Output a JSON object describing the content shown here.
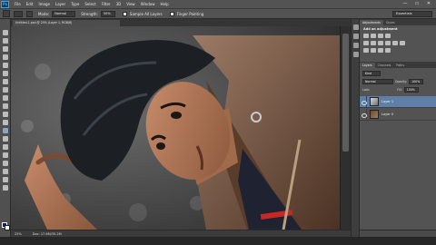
{
  "app": {
    "logo": "Ps"
  },
  "menu": [
    "File",
    "Edit",
    "Image",
    "Layer",
    "Type",
    "Select",
    "Filter",
    "3D",
    "View",
    "Window",
    "Help"
  ],
  "window_controls": [
    "—",
    "▭",
    "✕"
  ],
  "options": {
    "mode_label": "Mode:",
    "mode_value": "Normal",
    "strength_label": "Strength:",
    "strength_value": "50%",
    "sample_all_layers": "Sample All Layers",
    "finger_painting": "Finger Painting",
    "workspace": "Essentials"
  },
  "document": {
    "tab_title": "Untitled-1.psd @ 25% (Layer 1, RGB/8)",
    "zoom": "25%",
    "doc_size": "Doc: 17.6M/35.2M"
  },
  "panels": {
    "top_tabs": [
      "Adjustments",
      "Styles"
    ],
    "adjust_title": "Add an adjustment",
    "layer_tabs": [
      "Layers",
      "Channels",
      "Paths"
    ],
    "kind_label": "Kind",
    "blend_mode": "Normal",
    "opacity_label": "Opacity:",
    "opacity_value": "100%",
    "lock_label": "Lock:",
    "fill_label": "Fill:",
    "fill_value": "100%",
    "layers": [
      {
        "name": "Layer 1",
        "selected": true
      },
      {
        "name": "Layer 0",
        "selected": false
      }
    ]
  },
  "colors": {
    "foreground": "#0b1f7a",
    "background": "#ffffff",
    "selection": "#5f7fa6"
  }
}
